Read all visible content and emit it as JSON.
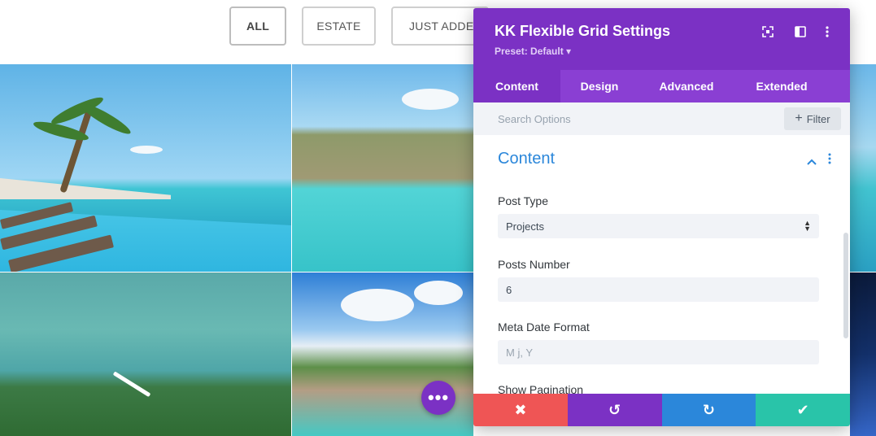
{
  "filters": [
    {
      "label": "ALL",
      "active": true
    },
    {
      "label": "ESTATE",
      "active": false
    },
    {
      "label": "JUST ADDED",
      "active": false
    },
    {
      "label": "",
      "active": false
    },
    {
      "label": "",
      "active": false
    }
  ],
  "panel": {
    "title": "KK Flexible Grid Settings",
    "preset": "Preset: Default ▾",
    "header_icons": [
      "expand-icon",
      "split-view-icon",
      "more-vertical-icon"
    ],
    "tabs": [
      {
        "label": "Content",
        "active": true
      },
      {
        "label": "Design",
        "active": false
      },
      {
        "label": "Advanced",
        "active": false
      },
      {
        "label": "Extended",
        "active": false
      }
    ],
    "search": {
      "placeholder": "Search Options",
      "filter_label": "Filter"
    },
    "section": {
      "title": "Content"
    },
    "fields": {
      "post_type": {
        "label": "Post Type",
        "value": "Projects"
      },
      "posts_number": {
        "label": "Posts Number",
        "value": "6"
      },
      "meta_date_format": {
        "label": "Meta Date Format",
        "placeholder": "M j, Y"
      },
      "show_pagination": {
        "label": "Show Pagination"
      }
    },
    "footer": {
      "cancel": "✖",
      "undo": "↺",
      "redo": "↻",
      "save": "✔"
    }
  },
  "floating_button": {
    "label": "•••"
  },
  "colors": {
    "purple": "#7b31c4",
    "purple_tab": "#8a3fd3",
    "blue": "#2b87da",
    "red": "#ef5555",
    "green": "#29c4a9"
  }
}
